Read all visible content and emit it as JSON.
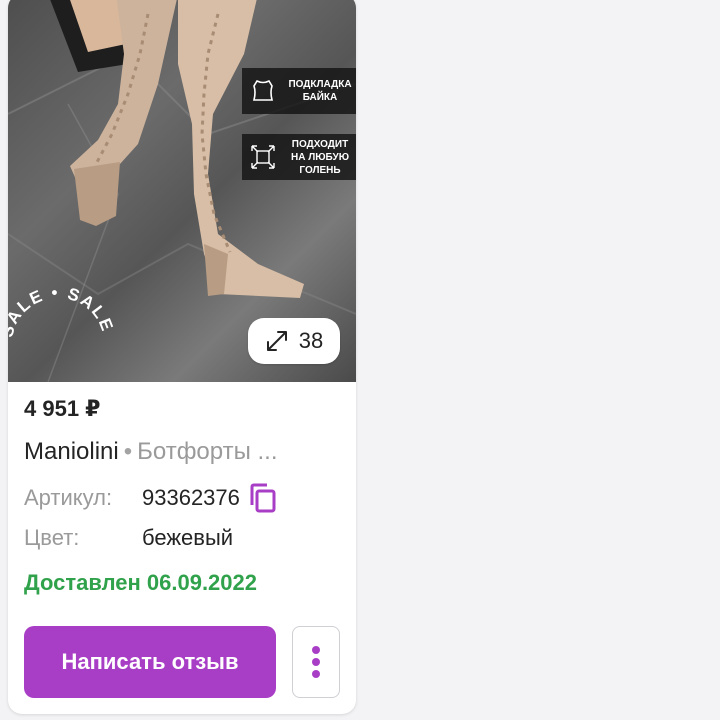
{
  "product_card": {
    "photo": {
      "badges": [
        {
          "icon": "hide-lining-icon",
          "text": "ПОДКЛАДКА БАЙКА"
        },
        {
          "icon": "stretch-arrows-icon",
          "text": "ПОДХОДИТ НА ЛЮБУЮ ГОЛЕНЬ"
        }
      ],
      "sale_ring_text": "SALE • SALE",
      "gallery_count": "38",
      "gallery_icon": "expand-arrows-icon"
    },
    "price": "4 951 ₽",
    "brand": "Maniolini",
    "separator": "•",
    "product_name": "Ботфорты ...",
    "article_label": "Артикул:",
    "article_value": "93362376",
    "color_label": "Цвет:",
    "color_value": "бежевый",
    "delivery_status": "Доставлен 06.09.2022",
    "review_button_label": "Написать отзыв",
    "more_icon": "kebab-menu-icon"
  },
  "colors": {
    "accent": "#a93ec6",
    "delivered_green": "#31a24c",
    "text_primary": "#242424",
    "text_secondary": "#9a9a9a"
  }
}
